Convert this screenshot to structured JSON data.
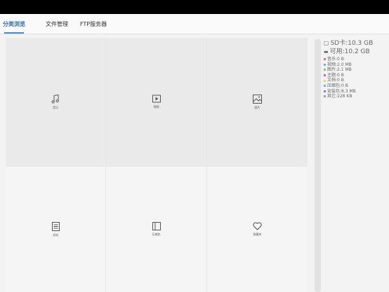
{
  "tabs": [
    {
      "label": "分类浏览",
      "active": true
    },
    {
      "label": "文件管理",
      "active": false
    },
    {
      "label": "FTP服务器",
      "active": false
    }
  ],
  "categories": [
    {
      "icon": "music-note-icon",
      "label": "音乐"
    },
    {
      "icon": "video-play-icon",
      "label": "视频"
    },
    {
      "icon": "image-icon",
      "label": "图片"
    },
    {
      "icon": "document-icon",
      "label": "文档"
    },
    {
      "icon": "book-icon",
      "label": "压缩包"
    },
    {
      "icon": "heart-icon",
      "label": "收藏夹"
    }
  ],
  "storage": {
    "sd_total": "SD卡:10.3 GB",
    "available": "可用:10.2 GB",
    "items": [
      {
        "label": "音乐:0 B",
        "color": "#e57373"
      },
      {
        "label": "视频:2.0 MB",
        "color": "#64b5f6"
      },
      {
        "label": "图片:2.1 MB",
        "color": "#81c784"
      },
      {
        "label": "主题:0 B",
        "color": "#ba68c8"
      },
      {
        "label": "文档:0 B",
        "color": "#ffd54f"
      },
      {
        "label": "压缩包:0 B",
        "color": "#4fc3f7"
      },
      {
        "label": "安装包:8.3 MB",
        "color": "#9575cd"
      },
      {
        "label": "其它:228 KB",
        "color": "#90a4ae"
      }
    ]
  }
}
